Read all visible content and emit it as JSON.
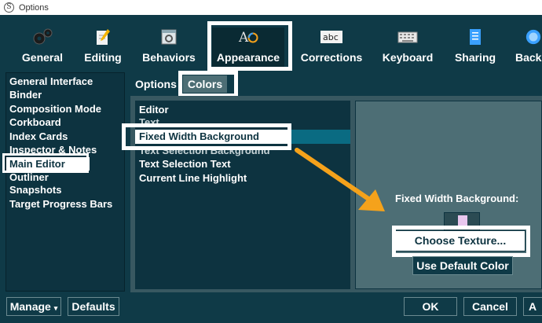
{
  "window": {
    "title": "Options"
  },
  "toolbar": {
    "items": [
      {
        "label": "General",
        "icon": "gears-icon"
      },
      {
        "label": "Editing",
        "icon": "pencil-paper-icon"
      },
      {
        "label": "Behaviors",
        "icon": "window-gear-icon"
      },
      {
        "label": "Appearance",
        "icon": "font-color-icon"
      },
      {
        "label": "Corrections",
        "icon": "abc-icon"
      },
      {
        "label": "Keyboard",
        "icon": "keyboard-icon"
      },
      {
        "label": "Sharing",
        "icon": "notebook-icon"
      },
      {
        "label": "Back",
        "icon": "backup-icon"
      }
    ]
  },
  "sidebar": {
    "items": [
      "General Interface",
      "Binder",
      "Composition Mode",
      "Corkboard",
      "Index Cards",
      "Inspector & Notes",
      "Main Editor",
      "Outliner",
      "Snapshots",
      "Target Progress Bars"
    ],
    "selected": "Main Editor"
  },
  "tabs": {
    "options": "Options",
    "colors": "Colors"
  },
  "colors_list": {
    "items": [
      "Editor",
      "Text",
      "Fixed Width Background",
      "Text Selection Background",
      "Text Selection Text",
      "Current Line Highlight"
    ],
    "selected": "Fixed Width Background"
  },
  "detail": {
    "label": "Fixed Width Background:",
    "swatch_color": "#e8c7ee",
    "choose_texture": "Choose Texture...",
    "use_default": "Use Default Color"
  },
  "bottom": {
    "manage": "Manage",
    "defaults": "Defaults",
    "ok": "OK",
    "cancel": "Cancel",
    "apply": "A"
  },
  "colors": {
    "background": "#0f3a47",
    "panel": "#385861",
    "arrow": "#f5a21b",
    "callout": "#ffffff"
  }
}
